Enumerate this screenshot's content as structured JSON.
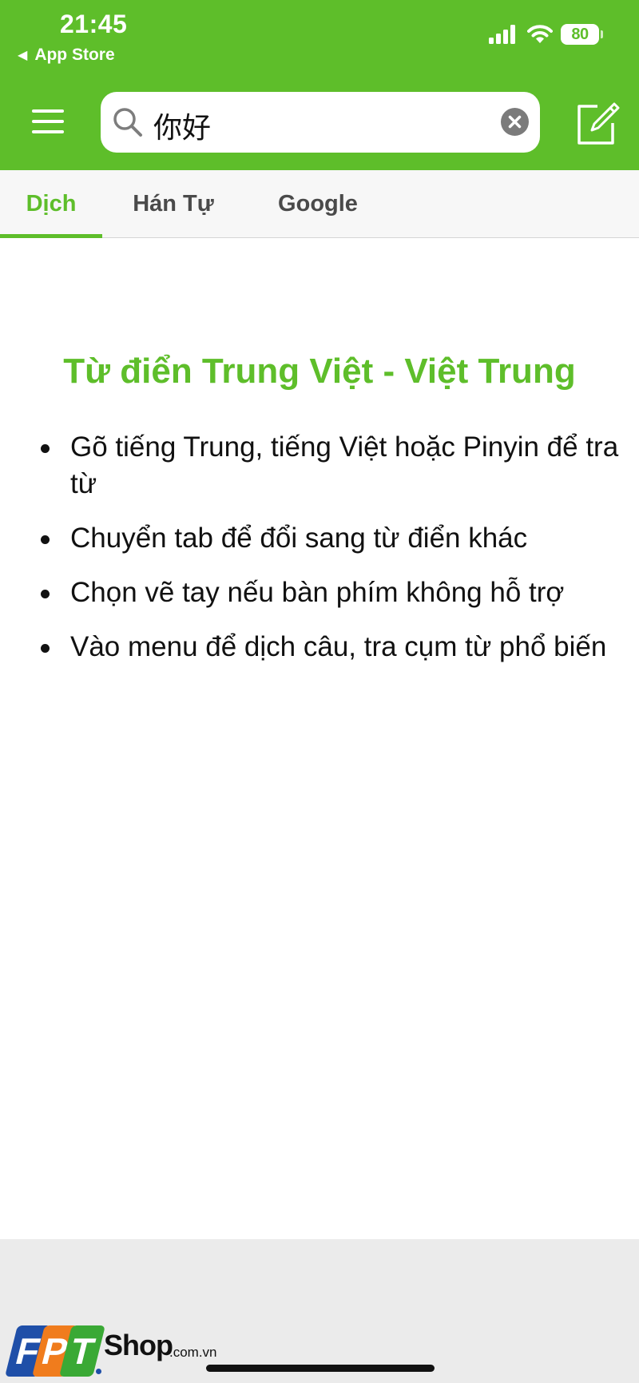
{
  "status_bar": {
    "time": "21:45",
    "back_label": "App Store",
    "battery_level": "80",
    "icons": [
      "cellular-signal-icon",
      "wifi-icon",
      "battery-icon"
    ]
  },
  "toolbar": {
    "menu_icon": "hamburger-menu-icon",
    "search_value": "你好",
    "search_icon": "magnifier-icon",
    "clear_icon": "clear-x-icon",
    "handwriting_icon": "pencil-edit-icon"
  },
  "tabs": [
    {
      "label": "Dịch",
      "active": true
    },
    {
      "label": "Hán Tự",
      "active": false
    },
    {
      "label": "Google",
      "active": false
    }
  ],
  "main": {
    "title": "Từ điển Trung Việt - Việt Trung",
    "tips": [
      "Gõ tiếng Trung, tiếng Việt hoặc Pinyin để tra từ",
      "Chuyển tab để đổi sang từ điển khác",
      "Chọn vẽ tay nếu bàn phím không hỗ trợ",
      "Vào menu để dịch câu, tra cụm từ phổ biến"
    ]
  },
  "watermark": {
    "letters": [
      "F",
      "P",
      "T"
    ],
    "shop": "Shop",
    "domain": ".com.vn"
  },
  "colors": {
    "brand_green": "#5ebe2a",
    "text_dark": "#111111",
    "tab_inactive": "#4a4a4a",
    "bottom_grey": "#ebebeb",
    "fpt_blue": "#1f4fa8",
    "fpt_orange": "#f07c1d",
    "fpt_green": "#3aa935"
  }
}
